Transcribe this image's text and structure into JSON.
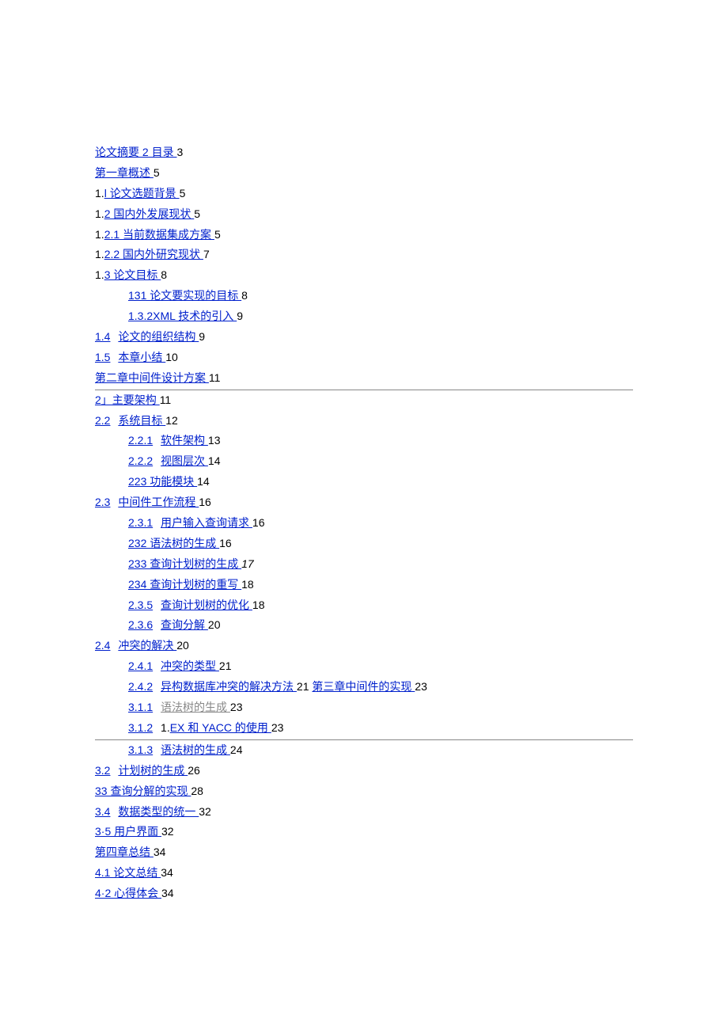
{
  "toc": {
    "l0_abstract": {
      "prefix": "",
      "text": "论文摘要 2 目录 ",
      "page": "3"
    },
    "l0_ch1": {
      "prefix": "",
      "text": "第一章概述 ",
      "page": "5"
    },
    "l0_1_1": {
      "prefix": "1.",
      "text": "l 论文选题背景 ",
      "page": "5"
    },
    "l0_1_2": {
      "prefix": "1.",
      "text": "2 国内外发展现状 ",
      "page": "5"
    },
    "l0_1_2_1": {
      "prefix": "1.",
      "text": "2.1 当前数据集成方案 ",
      "page": "5"
    },
    "l0_1_2_2": {
      "prefix": "1.",
      "text": "2.2 国内外研究现状 ",
      "page": "7"
    },
    "l0_1_3": {
      "prefix": "1.",
      "text": "3 论文目标 ",
      "page": "8"
    },
    "l1_131": {
      "prefix": "",
      "text": "131 论文要实现的目标 ",
      "page": "8"
    },
    "l1_1_3_2": {
      "prefix": "",
      "text": "1.3.2XML 技术的引入 ",
      "page": "9"
    },
    "l0_1_4": {
      "num": "1.4",
      "text": "论文的组织结构 ",
      "page": "9"
    },
    "l0_1_5": {
      "num": "1.5",
      "text": "本章小结 ",
      "page": "10"
    },
    "l0_ch2": {
      "text": "第二章中间件设计方案 ",
      "page": "11"
    },
    "l0_2_arch": {
      "text": "2」主要架构 ",
      "page": "11"
    },
    "l0_2_2": {
      "num": "2.2",
      "text": "系统目标 ",
      "page": "12"
    },
    "l1_2_2_1": {
      "num": "2.2.1",
      "text": "软件架构 ",
      "page": "13"
    },
    "l1_2_2_2": {
      "num": "2.2.2",
      "text": "视图层次 ",
      "page": "14"
    },
    "l1_223": {
      "text": "223 功能模块 ",
      "page": "14"
    },
    "l0_2_3": {
      "num": "2.3",
      "text": "中间件工作流程 ",
      "page": "16"
    },
    "l1_2_3_1": {
      "num": "2.3.1",
      "text": "用户输入查询请求 ",
      "page": "16"
    },
    "l1_232": {
      "text": "232 语法树的生成 ",
      "page": "16"
    },
    "l1_233": {
      "text": "233 查询计划树的生成 ",
      "page": "17"
    },
    "l1_234": {
      "text": "234 查询计划树的重写 ",
      "page": "18"
    },
    "l1_2_3_5": {
      "num": "2.3.5",
      "text": "查询计划树的优化 ",
      "page": "18"
    },
    "l1_2_3_6": {
      "num": "2.3.6",
      "text": "查询分解 ",
      "page": "20"
    },
    "l0_2_4": {
      "num": "2.4",
      "text": "冲突的解决 ",
      "page": "20"
    },
    "l1_2_4_1": {
      "num": "2.4.1",
      "text": "冲突的类型 ",
      "page": "21"
    },
    "l1_2_4_2": {
      "num": "2.4.2",
      "text": "异构数据库冲突的解决方法 ",
      "page": "21",
      "extra_text": "第三章中间件的实现 ",
      "extra_page": "23"
    },
    "l1_3_1_1": {
      "num": "3.1.1",
      "text": "语法树的生成 ",
      "page": "23"
    },
    "l1_3_1_2": {
      "num": "3.1.2",
      "prefix": "1.",
      "text": "EX 和 YACC 的使用 ",
      "page": "23"
    },
    "l1_3_1_3": {
      "num": "3.1.3",
      "text": "语法树的生成 ",
      "page": "24"
    },
    "l0_3_2": {
      "num": "3.2",
      "text": "计划树的生成 ",
      "page": "26"
    },
    "l0_33": {
      "text": "33 查询分解的实现 ",
      "page": "28"
    },
    "l0_3_4": {
      "num": "3.4",
      "text": "数据类型的统一 ",
      "page": "32"
    },
    "l0_3_5": {
      "text": "3·5 用户界面 ",
      "page": "32"
    },
    "l0_ch4": {
      "text": "第四章总结 ",
      "page": "34"
    },
    "l0_4_1": {
      "text": "4.1 论文总结 ",
      "page": "34"
    },
    "l0_4_2": {
      "text": "4·2 心得体会 ",
      "page": "34"
    }
  }
}
